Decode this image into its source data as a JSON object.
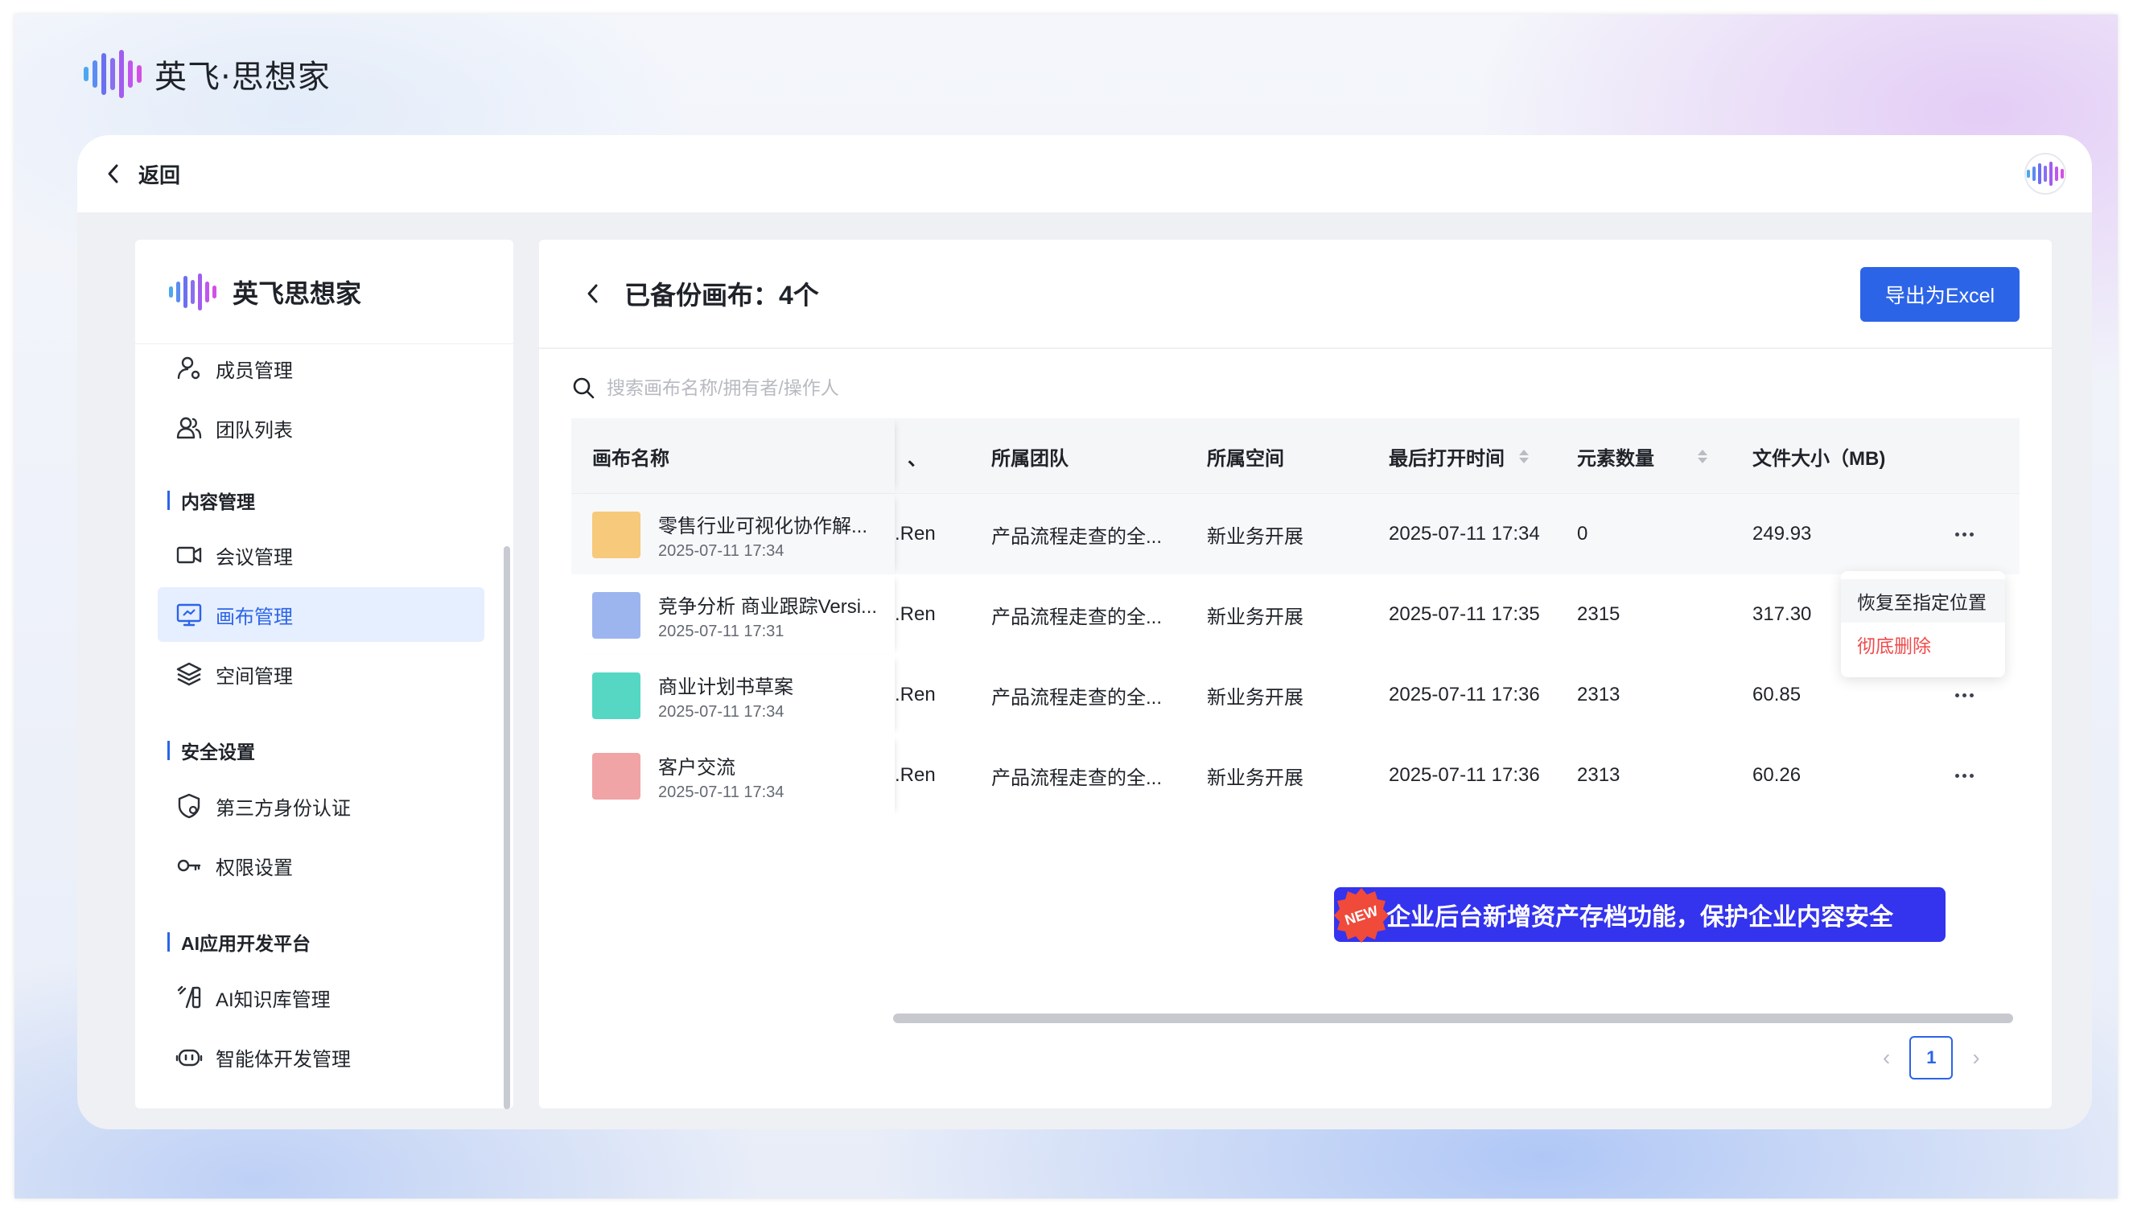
{
  "app": {
    "title": "英飞·思想家"
  },
  "header": {
    "back_label": "返回"
  },
  "sidebar": {
    "brand": "英飞思想家",
    "items": [
      {
        "label": "成员管理",
        "icon": "user-settings-icon",
        "active": false
      },
      {
        "label": "团队列表",
        "icon": "team-icon",
        "active": false
      },
      {
        "label": "会议管理",
        "icon": "video-icon",
        "active": false
      },
      {
        "label": "画布管理",
        "icon": "canvas-icon",
        "active": true
      },
      {
        "label": "空间管理",
        "icon": "layers-icon",
        "active": false
      },
      {
        "label": "第三方身份认证",
        "icon": "shield-icon",
        "active": false
      },
      {
        "label": "权限设置",
        "icon": "key-icon",
        "active": false
      },
      {
        "label": "AI知识库管理",
        "icon": "ai-knowledge-icon",
        "active": false
      },
      {
        "label": "智能体开发管理",
        "icon": "bot-icon",
        "active": false
      }
    ],
    "sections": [
      "内容管理",
      "安全设置",
      "AI应用开发平台"
    ]
  },
  "content": {
    "title": "已备份画布：4个",
    "export_label": "导出为Excel",
    "search_placeholder": "搜索画布名称/拥有者/操作人",
    "columns": {
      "name": "画布名称",
      "team": "所属团队",
      "space": "所属空间",
      "last_opened": "最后打开时间",
      "elements": "元素数量",
      "size": "文件大小（MB)"
    },
    "rows": [
      {
        "title": "零售行业可视化协作解...",
        "date": "2025-07-11 17:34",
        "owner": ".Ren",
        "team": "产品流程走查的全...",
        "space": "新业务开展",
        "last_opened": "2025-07-11 17:34",
        "elements": "0",
        "size": "249.93",
        "color": "#f7c97a"
      },
      {
        "title": "竞争分析 商业跟踪Versi...",
        "date": "2025-07-11 17:31",
        "owner": ".Ren",
        "team": "产品流程走查的全...",
        "space": "新业务开展",
        "last_opened": "2025-07-11 17:35",
        "elements": "2315",
        "size": "317.30",
        "color": "#9db5ef"
      },
      {
        "title": "商业计划书草案",
        "date": "2025-07-11 17:34",
        "owner": ".Ren",
        "team": "产品流程走查的全...",
        "space": "新业务开展",
        "last_opened": "2025-07-11 17:36",
        "elements": "2313",
        "size": "60.85",
        "color": "#55d7c4"
      },
      {
        "title": "客户交流",
        "date": "2025-07-11 17:34",
        "owner": ".Ren",
        "team": "产品流程走查的全...",
        "space": "新业务开展",
        "last_opened": "2025-07-11 17:36",
        "elements": "2313",
        "size": "60.26",
        "color": "#f0a4a6"
      }
    ],
    "menu": {
      "restore": "恢复至指定位置",
      "delete": "彻底删除"
    },
    "promo": "企业后台新增资产存档功能，保护企业内容安全",
    "new_badge": "NEW",
    "pager": {
      "current": "1"
    }
  }
}
